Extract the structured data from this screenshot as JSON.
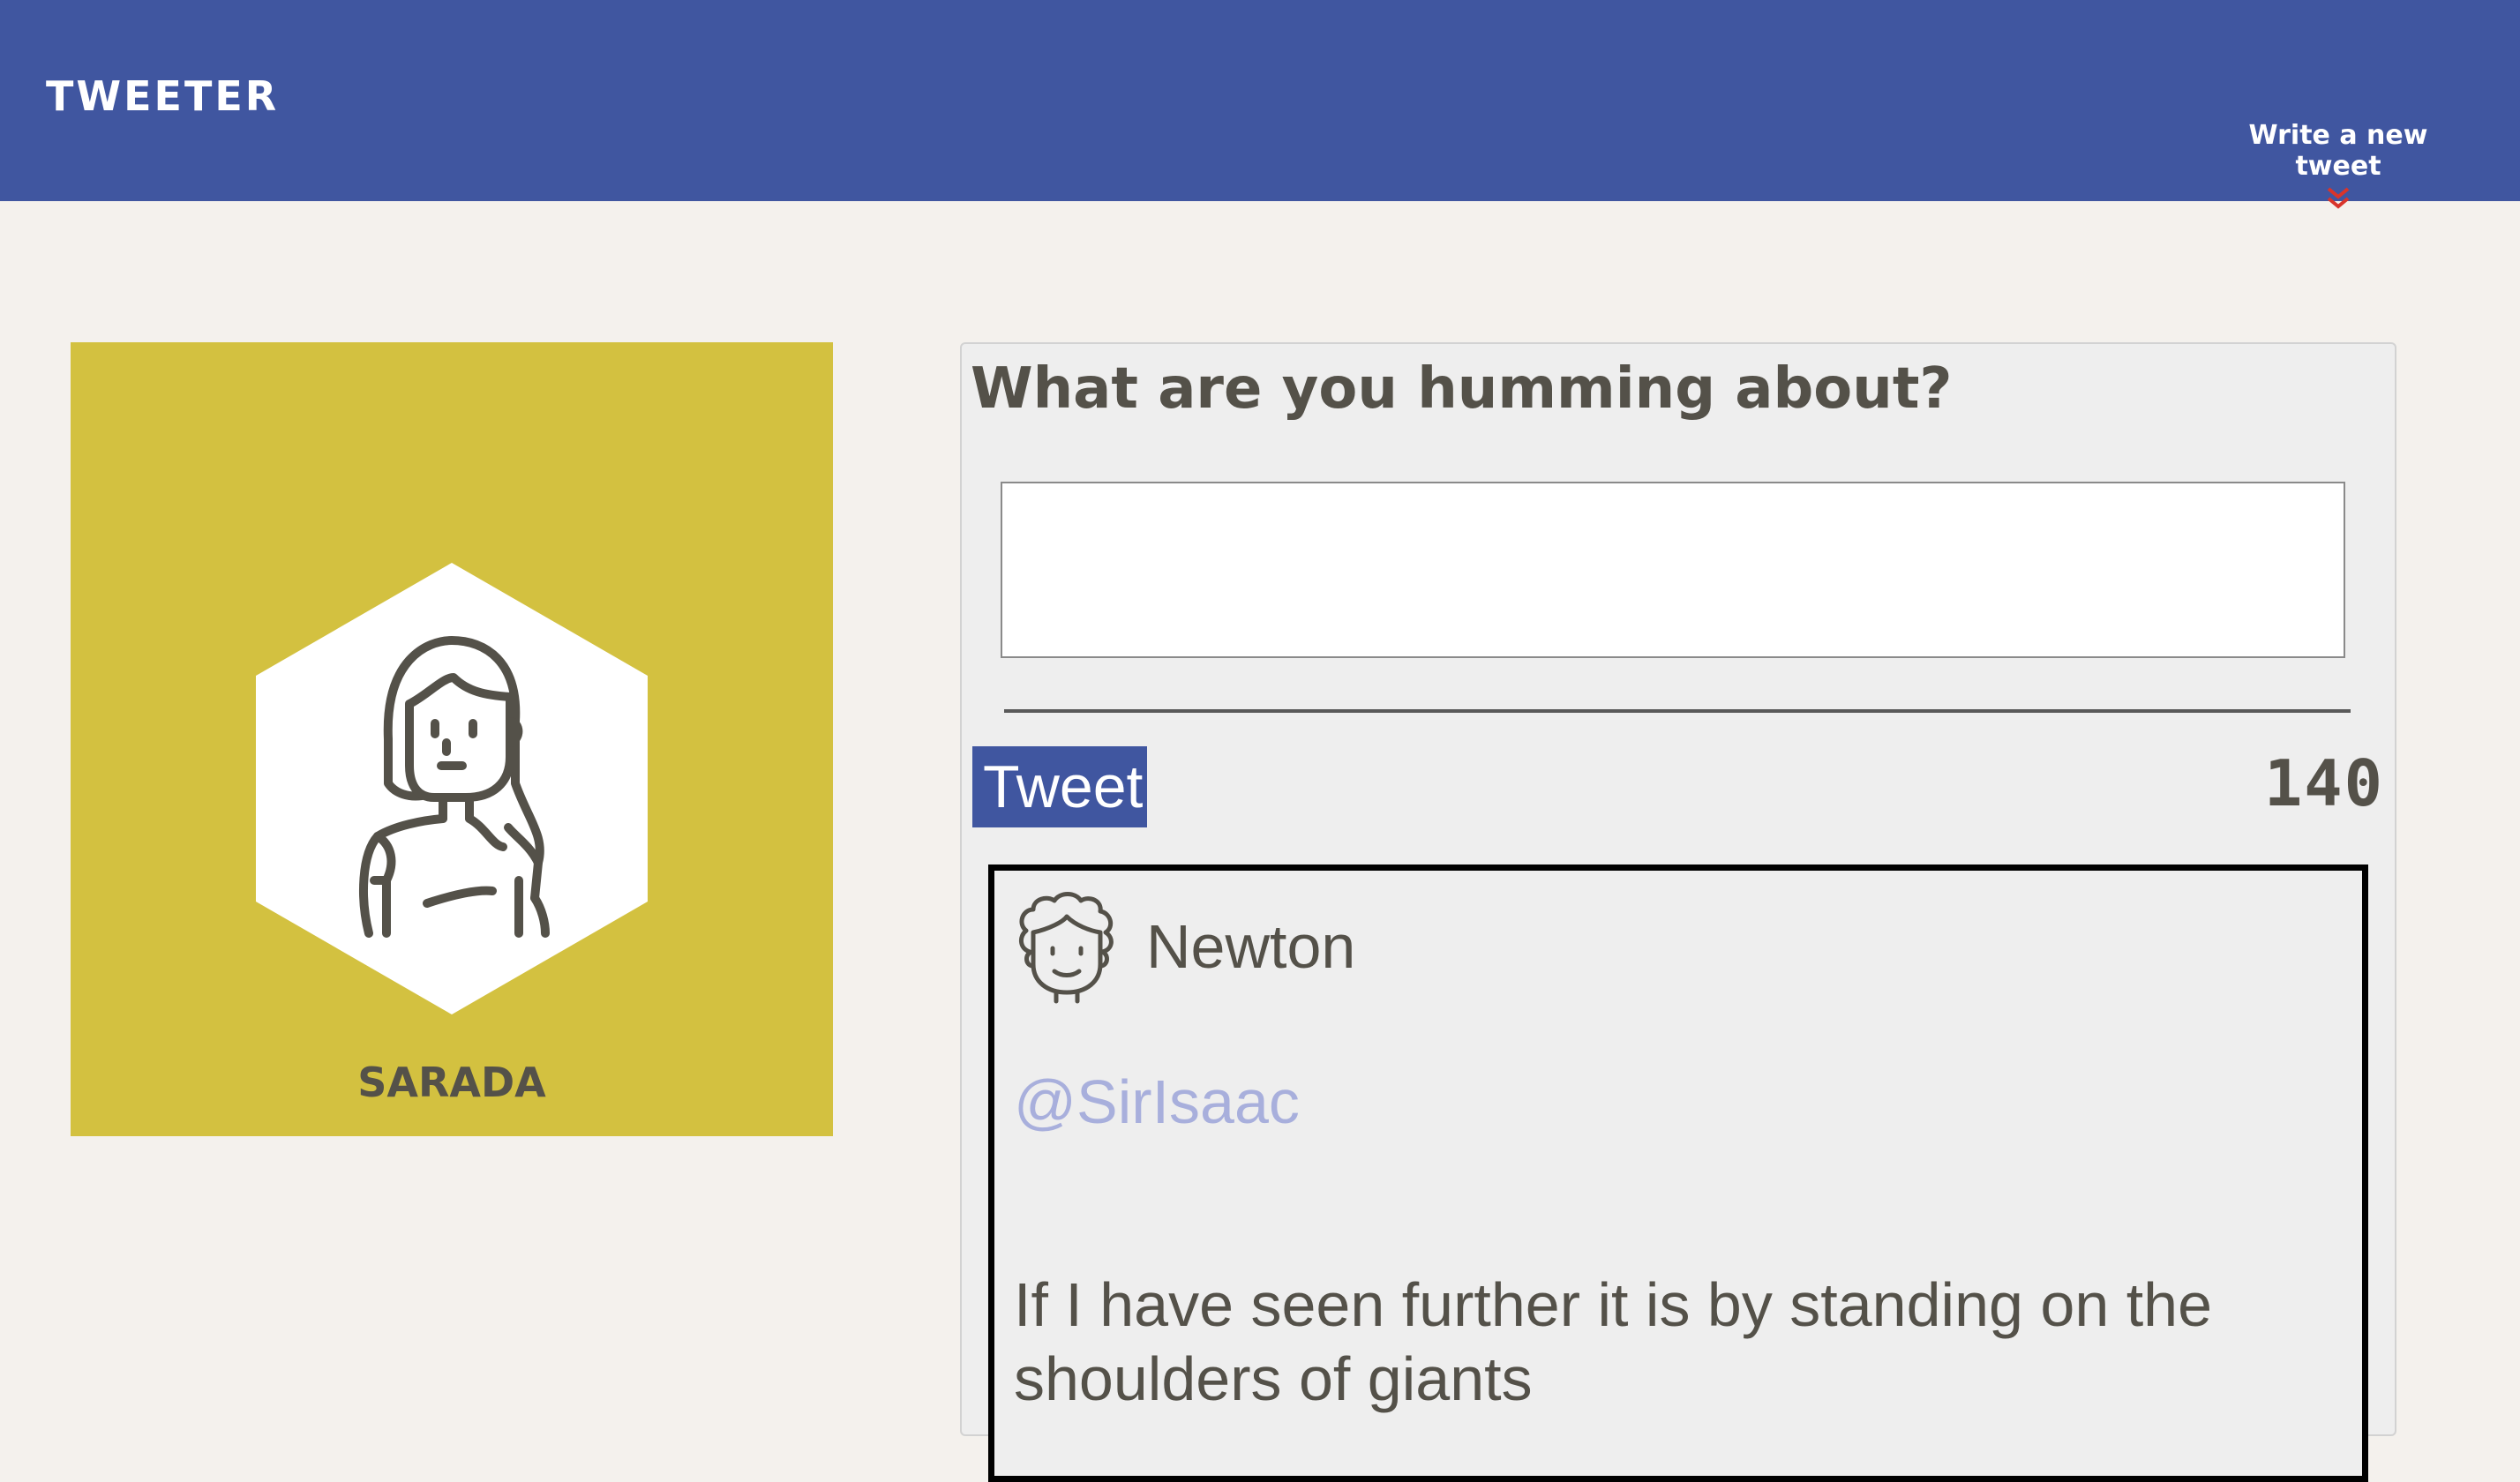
{
  "nav": {
    "brand": "TWEETER",
    "compose_toggle_label": "Write a new tweet",
    "compose_toggle_icon": "double-chevron-down-icon"
  },
  "profile": {
    "name": "SARADA",
    "avatar_icon": "girl-avatar-icon",
    "card_color": "#d3c140"
  },
  "compose": {
    "title": "What are you humming about?",
    "input_value": "",
    "input_placeholder": "",
    "button_label": "Tweet",
    "char_counter": "140"
  },
  "tweets": [
    {
      "avatar_icon": "curly-hair-man-avatar-icon",
      "author": "Newton",
      "handle": "@SirIsaac",
      "text": "If I have seen further it is by standing on the shoulders of giants"
    }
  ],
  "colors": {
    "nav_bg": "#4056a0",
    "page_bg": "#f4f1ed",
    "accent_red": "#d9342b",
    "handle": "#a8afdc"
  }
}
